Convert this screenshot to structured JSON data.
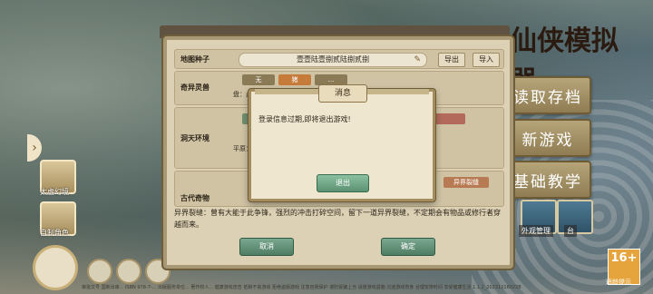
{
  "logo_text": "仙侠模拟器",
  "menu": {
    "load_save": "读取存档",
    "new_game": "新游戏",
    "tutorial": "基础教学"
  },
  "small_buttons": {
    "outer_manage": "外观管理",
    "stage": "台"
  },
  "left_panel": {
    "item1": "太虚幻境",
    "item2": "自制角色"
  },
  "rating": {
    "age": "16+",
    "caption": "适龄提示"
  },
  "footer": "审批文号 国新出审... ISBN 978-7-... 出版服务单位... 著作权人... 健康游戏忠告 抵制不良游戏 拒绝盗版游戏 注意自我保护 谨防受骗上当 适度游戏益脑 沉迷游戏伤身 合理安排时间 享受健康生活 1.1.2_20231216022B",
  "settings": {
    "seed_label": "地图种子",
    "seed_value": "壹壹陆壹捌贰陆捌贰捌",
    "export_label": "导出",
    "import_label": "导入",
    "spirit_label": "奇异灵兽",
    "spirit_options": [
      "无",
      "猪",
      "..."
    ],
    "spirit_desc": "盘：此",
    "realm_label": "洞天环境",
    "realm_desc": "平原：...",
    "artifact_label": "古代奇物",
    "artifact_desc": "异界裂缝：曾有大能于此争锋，强烈的冲击打碎空间，留下一道异界裂缝，不定期会有物品或修行者穿越而来。",
    "artifact_chip": "异界裂缝",
    "cancel_label": "取消",
    "confirm_label": "确定"
  },
  "dialog": {
    "title": "消息",
    "message": "登录信息过期,即将退出游戏!",
    "button": "退出"
  }
}
